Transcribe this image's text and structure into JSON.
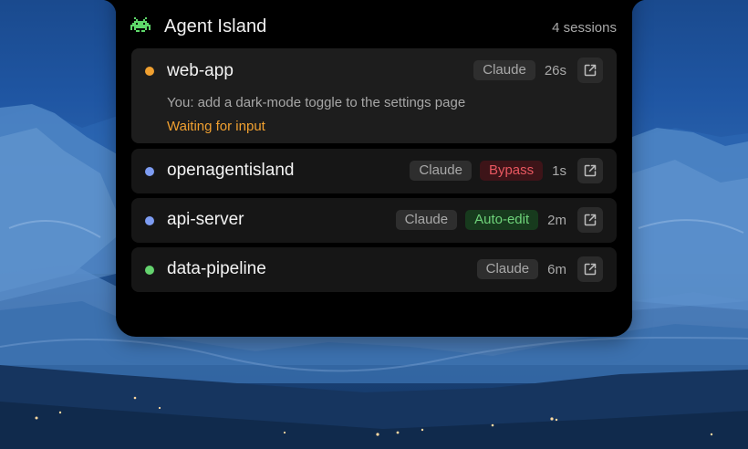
{
  "header": {
    "title": "Agent Island",
    "session_count": "4 sessions",
    "logo_icon": "space-invader-icon"
  },
  "sessions": [
    {
      "name": "web-app",
      "status_color": "#f0a030",
      "agent": "Claude",
      "elapsed": "26s",
      "message": "You: add a dark-mode toggle to the settings page",
      "status_text": "Waiting for input"
    },
    {
      "name": "openagentisland",
      "status_color": "#7d9cf2",
      "agent": "Claude",
      "mode": "Bypass",
      "elapsed": "1s"
    },
    {
      "name": "api-server",
      "status_color": "#7d9cf2",
      "agent": "Claude",
      "mode": "Auto-edit",
      "elapsed": "2m"
    },
    {
      "name": "data-pipeline",
      "status_color": "#64d36e",
      "agent": "Claude",
      "elapsed": "6m"
    }
  ],
  "colors": {
    "accent_waiting": "#f0a030",
    "bypass": "#e85760",
    "auto_edit": "#6fd37a",
    "logo": "#5fd86a"
  }
}
